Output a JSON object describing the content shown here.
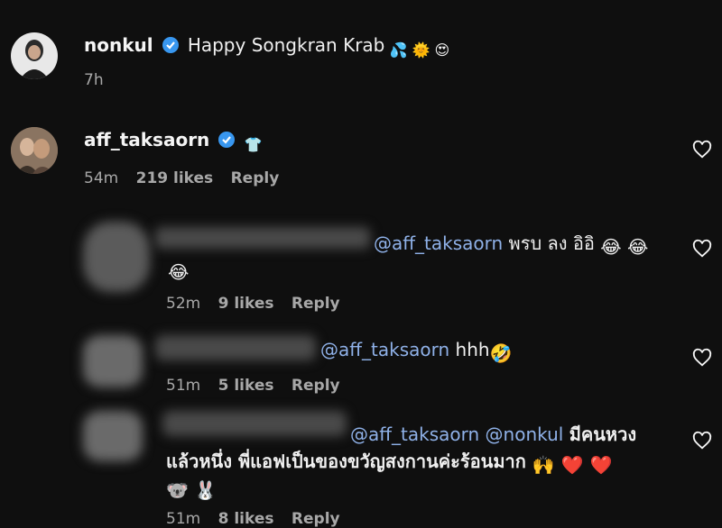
{
  "post": {
    "username": "nonkul",
    "caption": "Happy Songkran Krab",
    "emojis": [
      "💦",
      "🌞",
      "😍"
    ],
    "time": "7h"
  },
  "comments": [
    {
      "username": "aff_taksaorn",
      "text": "",
      "emoji": "👕",
      "time": "54m",
      "likes": "219 likes",
      "reply": "Reply"
    },
    {
      "mention": "@aff_taksaorn",
      "text": "พรบ ลง อิอิ",
      "emojis": [
        "😂",
        "😂",
        "😂"
      ],
      "time": "52m",
      "likes": "9 likes",
      "reply": "Reply"
    },
    {
      "mention": "@aff_taksaorn",
      "text": "hhh",
      "emojis": [
        "🤣"
      ],
      "time": "51m",
      "likes": "5 likes",
      "reply": "Reply"
    },
    {
      "mention": "@aff_taksaorn @nonkul",
      "text_line1": "มีคนหวง",
      "text_line2": "แล้วหนึ่ง พี่แอฟเป็นของขวัญสงกานค่ะร้อนมาก",
      "emojis_line2": [
        "🙌",
        "❤️",
        "❤️"
      ],
      "emojis_line3": [
        "🐨",
        "🐰"
      ],
      "time": "51m",
      "likes": "8 likes",
      "reply": "Reply"
    }
  ],
  "colors": {
    "background": "#0f0f0f",
    "verified": "#3897f0",
    "mention": "#8fb1e8",
    "meta": "#a8a8a8"
  }
}
